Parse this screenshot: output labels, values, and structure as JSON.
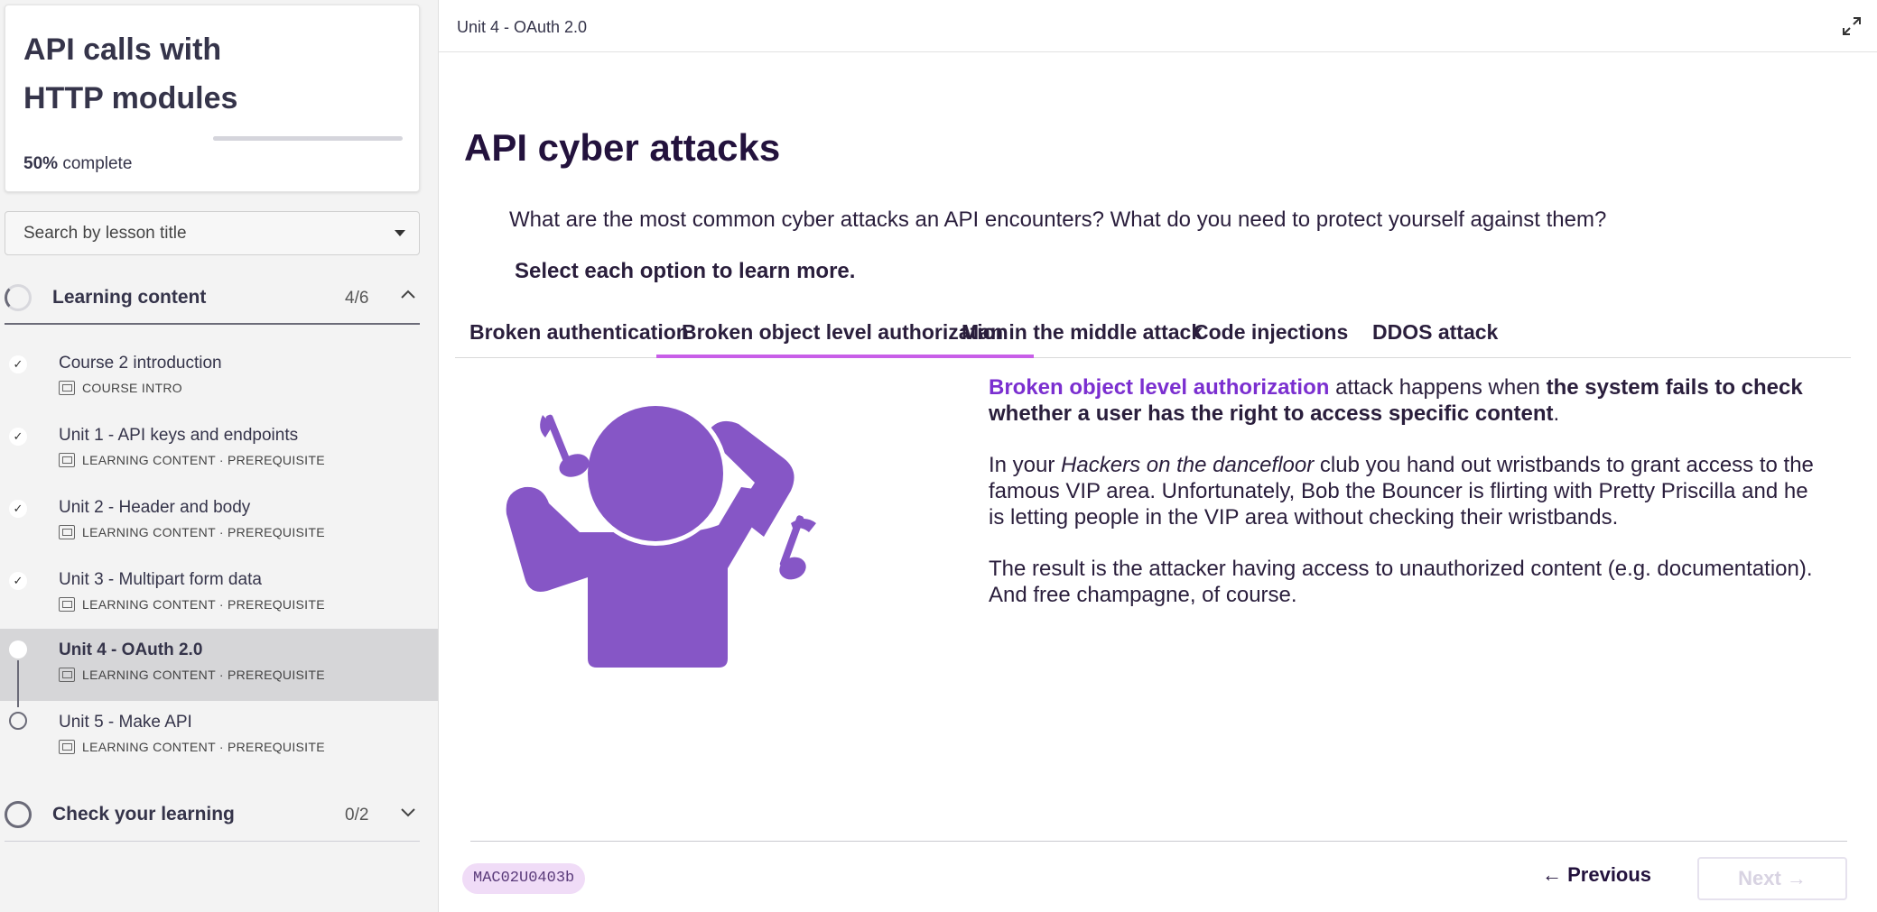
{
  "sidebar": {
    "course_title": "API calls with HTTP modules",
    "progress_percent": "50%",
    "progress_suffix": "complete",
    "progress_fraction": 0.5,
    "search_placeholder": "Search by lesson title",
    "sections": [
      {
        "title": "Learning content",
        "count": "4/6",
        "expanded": true,
        "lessons": [
          {
            "title": "Course 2 introduction",
            "meta": "COURSE INTRO",
            "status": "done"
          },
          {
            "title": "Unit 1 - API keys and endpoints",
            "meta": "LEARNING CONTENT · PREREQUISITE",
            "status": "done"
          },
          {
            "title": "Unit 2 - Header and body",
            "meta": "LEARNING CONTENT · PREREQUISITE",
            "status": "done"
          },
          {
            "title": "Unit 3 - Multipart form data",
            "meta": "LEARNING CONTENT · PREREQUISITE",
            "status": "done"
          },
          {
            "title": "Unit 4 - OAuth 2.0",
            "meta": "LEARNING CONTENT · PREREQUISITE",
            "status": "current"
          },
          {
            "title": "Unit 5 - Make API",
            "meta": "LEARNING CONTENT · PREREQUISITE",
            "status": "todo"
          }
        ]
      },
      {
        "title": "Check your learning",
        "count": "0/2",
        "expanded": false
      }
    ]
  },
  "main": {
    "breadcrumb": "Unit 4 - OAuth 2.0",
    "heading": "API cyber attacks",
    "question": "What are the most common cyber attacks an API encounters? What do you need to protect yourself against them?",
    "instruction": "Select each option to learn more.",
    "tabs": [
      {
        "label": "Broken authentication",
        "selected": false
      },
      {
        "label": "Broken object level authorization",
        "selected": true
      },
      {
        "label": "Man in the middle attack",
        "selected": false
      },
      {
        "label": "Code injections",
        "selected": false
      },
      {
        "label": "DDOS attack",
        "selected": false
      }
    ],
    "panel": {
      "p1_accent": "Broken object level authorization",
      "p1_mid": " attack happens when ",
      "p1_bold": "the system fails to check whether a user has the right to access specific content",
      "p1_end": ".",
      "p2_start": "In your ",
      "p2_italic": "Hackers on the dancefloor",
      "p2_end": " club you hand out wristbands to grant access to the famous VIP area. Unfortunately, Bob the Bouncer is flirting with Pretty Priscilla and he is letting people in the VIP area without checking their wristbands.",
      "p3": "The result is the attacker having access to unauthorized content (e.g. documentation). And free champagne, of course."
    },
    "illustration_icon": "dancing-person-icon",
    "footer": {
      "code": "MAC02U0403b",
      "previous": "← Previous",
      "next": "Next →"
    }
  },
  "colors": {
    "accent": "#7b2fd0",
    "tab_underline": "#c85ee8",
    "illustration": "#8656c6",
    "heading": "#23123d"
  }
}
